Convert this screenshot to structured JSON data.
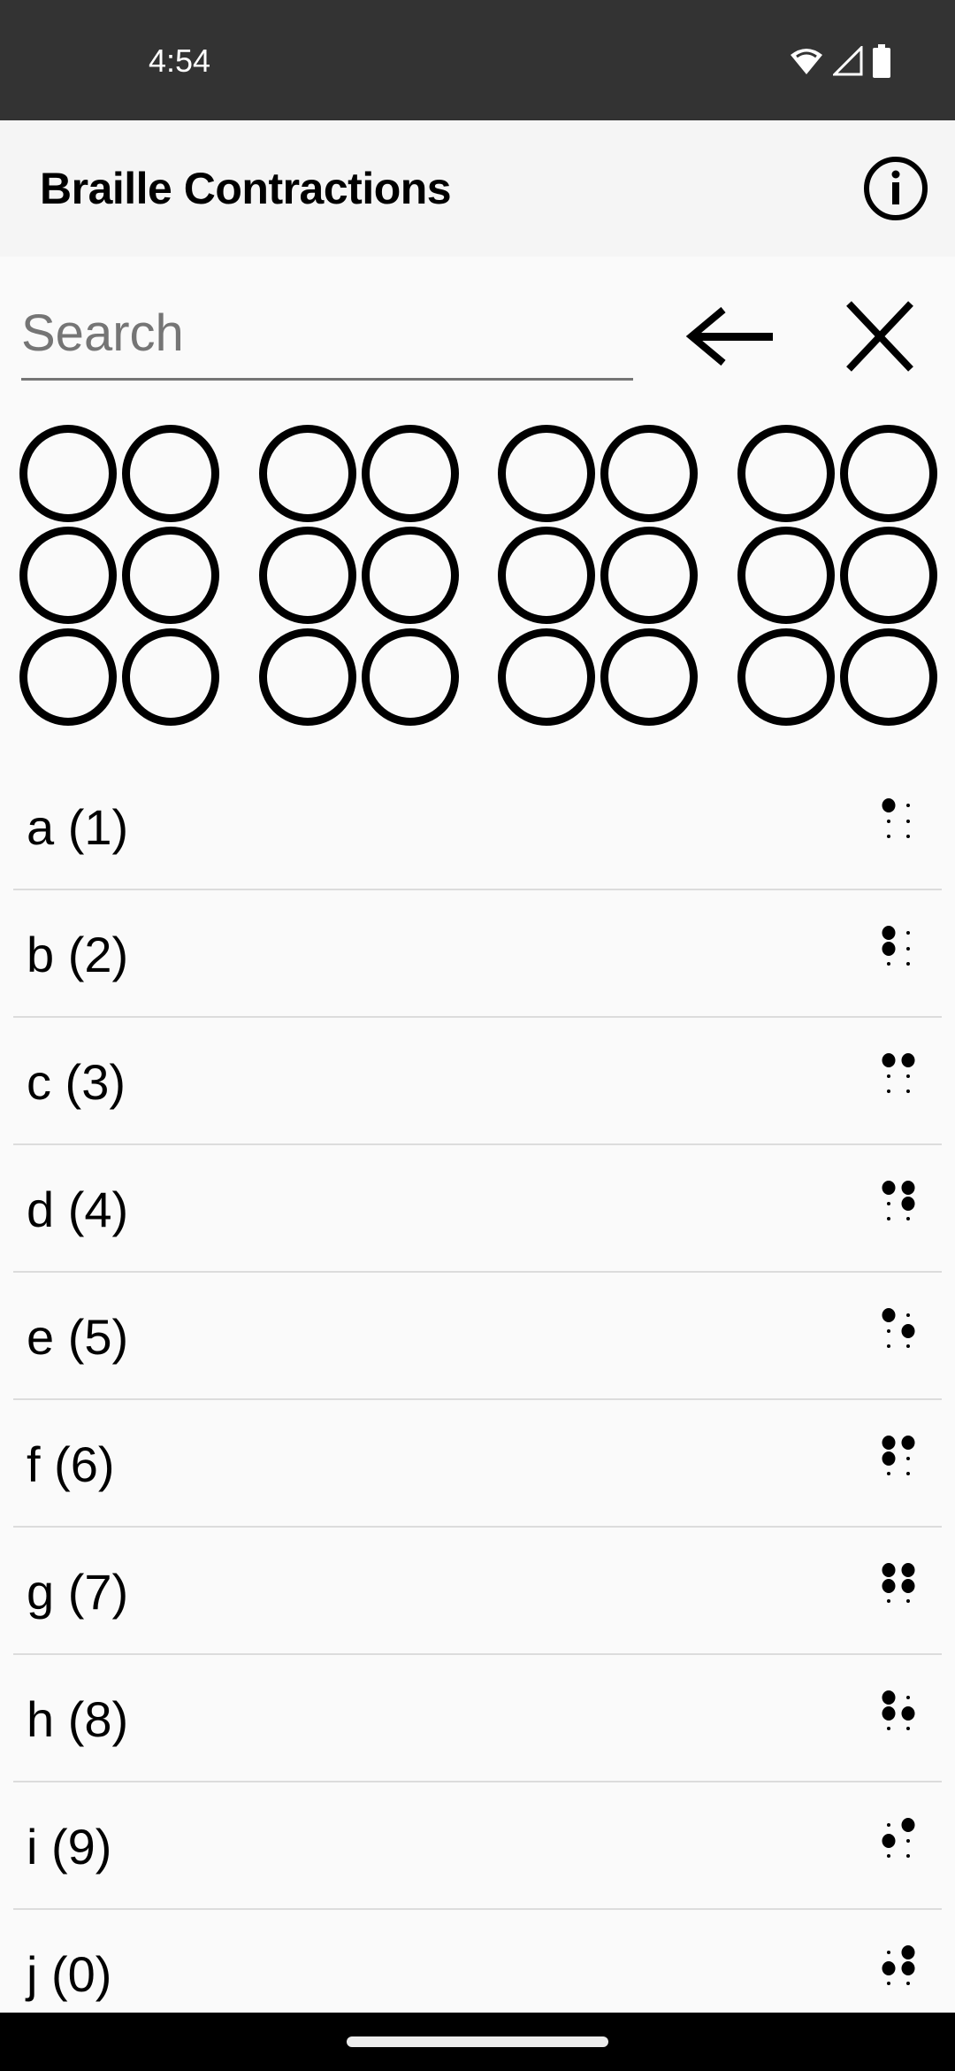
{
  "status_bar": {
    "time": "4:54",
    "icons": [
      "wifi-icon",
      "cellular-signal-icon",
      "battery-icon"
    ]
  },
  "app_bar": {
    "title": "Braille Contractions",
    "info_icon": "info-icon"
  },
  "search": {
    "value": "",
    "placeholder": "Search",
    "back_icon": "arrow-left-icon",
    "clear_icon": "close-icon"
  },
  "braille_input": {
    "cells": [
      {
        "dots": [
          false,
          false,
          false,
          false,
          false,
          false
        ]
      },
      {
        "dots": [
          false,
          false,
          false,
          false,
          false,
          false
        ]
      },
      {
        "dots": [
          false,
          false,
          false,
          false,
          false,
          false
        ]
      },
      {
        "dots": [
          false,
          false,
          false,
          false,
          false,
          false
        ]
      }
    ]
  },
  "entries": [
    {
      "label": "a (1)",
      "dots": [
        1
      ]
    },
    {
      "label": "b (2)",
      "dots": [
        1,
        2
      ]
    },
    {
      "label": "c (3)",
      "dots": [
        1,
        4
      ]
    },
    {
      "label": "d (4)",
      "dots": [
        1,
        4,
        5
      ]
    },
    {
      "label": "e (5)",
      "dots": [
        1,
        5
      ]
    },
    {
      "label": "f (6)",
      "dots": [
        1,
        2,
        4
      ]
    },
    {
      "label": "g (7)",
      "dots": [
        1,
        2,
        4,
        5
      ]
    },
    {
      "label": "h (8)",
      "dots": [
        1,
        2,
        5
      ]
    },
    {
      "label": "i (9)",
      "dots": [
        2,
        4
      ]
    },
    {
      "label": "j (0)",
      "dots": [
        2,
        4,
        5
      ]
    }
  ]
}
